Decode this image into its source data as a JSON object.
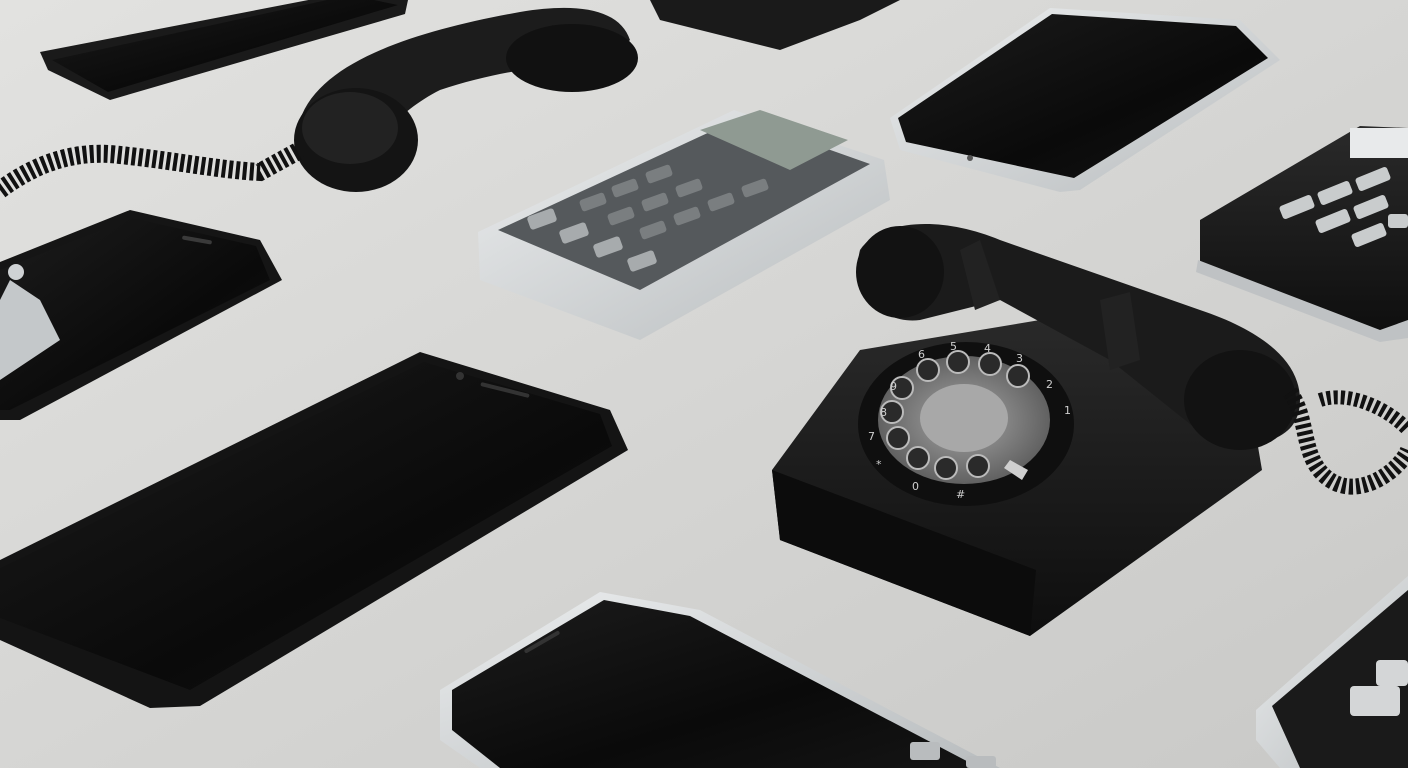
{
  "scene": {
    "background_color": "#d6d6d4",
    "subject": "phones and dialing devices arranged on a light grey surface",
    "colors": {
      "device_black": "#151515",
      "screen_black": "#0b0b0b",
      "silver": "#cfd2d4",
      "key_grey": "#9a9d9f",
      "lcd": "#8f9a92"
    }
  },
  "rotary_phone": {
    "dial_numbers": [
      "1",
      "2",
      "3",
      "4",
      "5",
      "6",
      "7",
      "8",
      "9",
      "0"
    ],
    "dial_symbols": [
      "*",
      "#"
    ]
  }
}
